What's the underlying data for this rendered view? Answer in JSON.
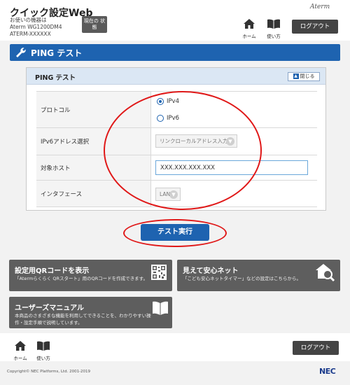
{
  "header": {
    "app_title": "クイック設定Web",
    "device_caption": "お使いの機器は",
    "device_model": "Aterm WG1200DM4",
    "device_id": "ATERM-XXXXXX",
    "status_button": "現在の 状態",
    "brand": "Aterm",
    "home_label": "ホーム",
    "usage_label": "使い方",
    "logout_label": "ログアウト"
  },
  "page": {
    "title": "PING テスト"
  },
  "panel": {
    "title": "PING テスト",
    "collapse_label": "閉じる",
    "protocol_label": "プロトコル",
    "ipv4_label": "IPv4",
    "ipv6_label": "IPv6",
    "selected_protocol": "IPv4",
    "ipv6_addr_label": "IPv6アドレス選択",
    "ipv6_addr_value": "リンクローカルアドレス入力",
    "target_host_label": "対象ホスト",
    "target_host_value": "XXX.XXX.XXX.XXX",
    "interface_label": "インタフェース",
    "interface_value": "LAN"
  },
  "test_button": "テスト実行",
  "tiles": {
    "qr_title": "設定用QRコードを表示",
    "qr_desc": "「Atermらくらく QRスタート」用のQRコードを作成できます。",
    "safety_title": "見えて安心ネット",
    "safety_desc": "「こども安心ネットタイマー」などの設定はこちらから。",
    "manual_title": "ユーザーズマニュアル",
    "manual_desc_line1": "本商品のさまざまな機能を利用してできることを、わかりやすい操",
    "manual_desc_line2": "作・設定手順で説明しています。"
  },
  "footer": {
    "home_label": "ホーム",
    "usage_label": "使い方",
    "logout_label": "ログアウト",
    "copyright": "Copyright© NEC Platforms, Ltd. 2001-2019",
    "logo": "NEC"
  },
  "colors": {
    "primary_blue": "#1e63b0",
    "annotation_red": "#e01818",
    "tile_gray": "#5e5e5e"
  }
}
